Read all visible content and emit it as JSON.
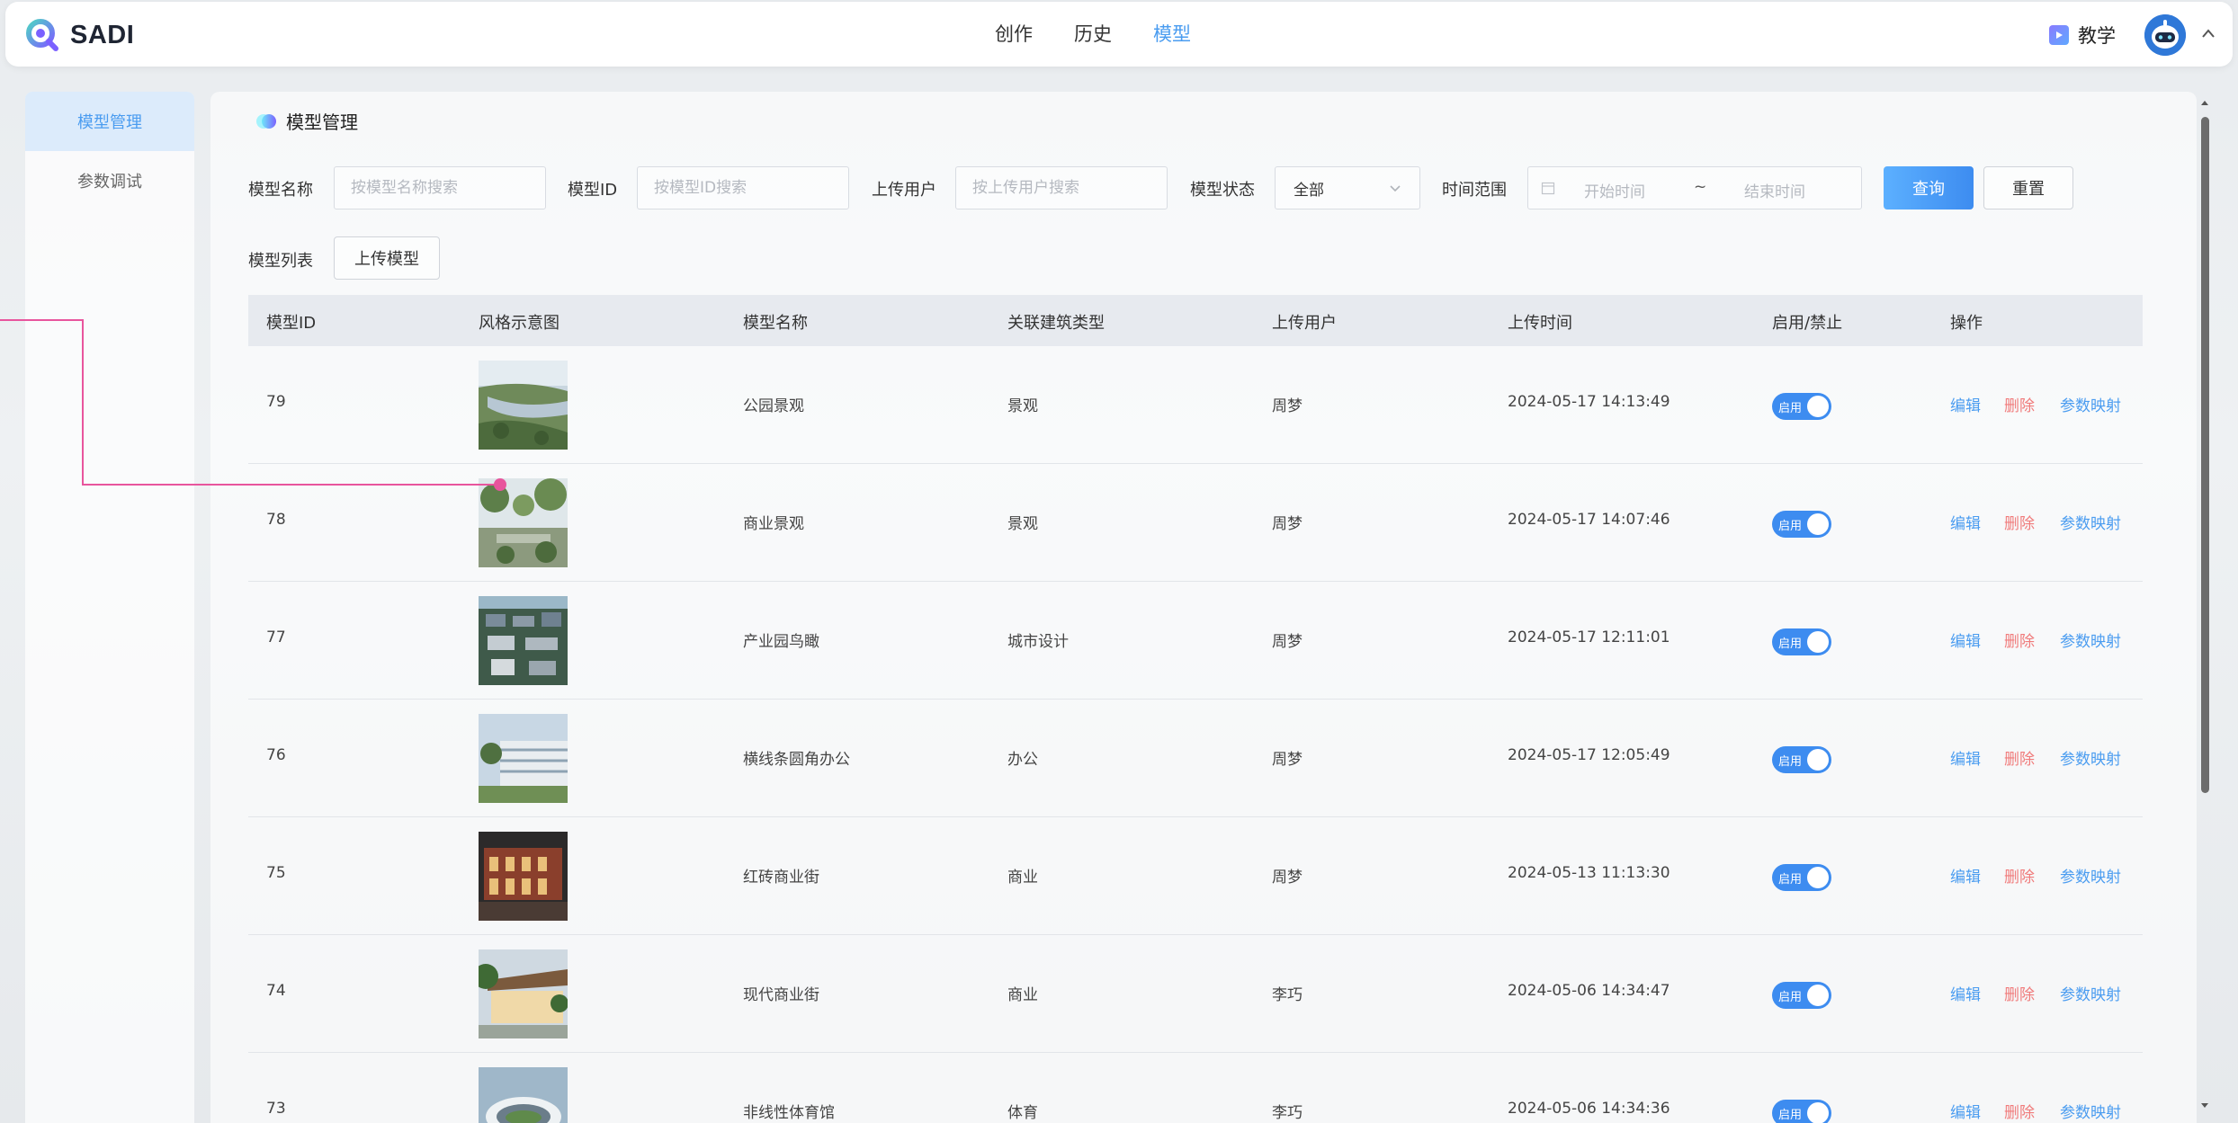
{
  "app": {
    "name": "SADI"
  },
  "nav": {
    "items": [
      "创作",
      "历史",
      "模型"
    ],
    "active_index": 2
  },
  "header": {
    "teach_label": "教学"
  },
  "sidebar": {
    "items": [
      "模型管理",
      "参数调试"
    ],
    "active_index": 0
  },
  "panel": {
    "title": "模型管理"
  },
  "filters": {
    "name_label": "模型名称",
    "name_placeholder": "按模型名称搜索",
    "id_label": "模型ID",
    "id_placeholder": "按模型ID搜索",
    "user_label": "上传用户",
    "user_placeholder": "按上传用户搜索",
    "status_label": "模型状态",
    "status_value": "全部",
    "time_label": "时间范围",
    "start_placeholder": "开始时间",
    "separator": "~",
    "end_placeholder": "结束时间",
    "query_button": "查询",
    "reset_button": "重置"
  },
  "list": {
    "label": "模型列表",
    "upload_button": "上传模型"
  },
  "table": {
    "columns": [
      "模型ID",
      "风格示意图",
      "模型名称",
      "关联建筑类型",
      "上传用户",
      "上传时间",
      "启用/禁止",
      "操作"
    ],
    "rows": [
      {
        "id": "79",
        "name": "公园景观",
        "type": "景观",
        "user": "周梦",
        "time": "2024-05-17 14:13:49",
        "enabled": "启用",
        "thumb": "park"
      },
      {
        "id": "78",
        "name": "商业景观",
        "type": "景观",
        "user": "周梦",
        "time": "2024-05-17 14:07:46",
        "enabled": "启用",
        "thumb": "garden"
      },
      {
        "id": "77",
        "name": "产业园鸟瞰",
        "type": "城市设计",
        "user": "周梦",
        "time": "2024-05-17 12:11:01",
        "enabled": "启用",
        "thumb": "aerial"
      },
      {
        "id": "76",
        "name": "横线条圆角办公",
        "type": "办公",
        "user": "周梦",
        "time": "2024-05-17 12:05:49",
        "enabled": "启用",
        "thumb": "office"
      },
      {
        "id": "75",
        "name": "红砖商业街",
        "type": "商业",
        "user": "周梦",
        "time": "2024-05-13 11:13:30",
        "enabled": "启用",
        "thumb": "brick"
      },
      {
        "id": "74",
        "name": "现代商业街",
        "type": "商业",
        "user": "李巧",
        "time": "2024-05-06 14:34:47",
        "enabled": "启用",
        "thumb": "modern"
      },
      {
        "id": "73",
        "name": "非线性体育馆",
        "type": "体育",
        "user": "李巧",
        "time": "2024-05-06 14:34:36",
        "enabled": "启用",
        "thumb": "stadium"
      }
    ],
    "actions": {
      "edit": "编辑",
      "delete": "删除",
      "map": "参数映射"
    }
  },
  "colors": {
    "accent": "#4a9cf0",
    "danger": "#f07b7b",
    "connector": "#e8559d"
  }
}
